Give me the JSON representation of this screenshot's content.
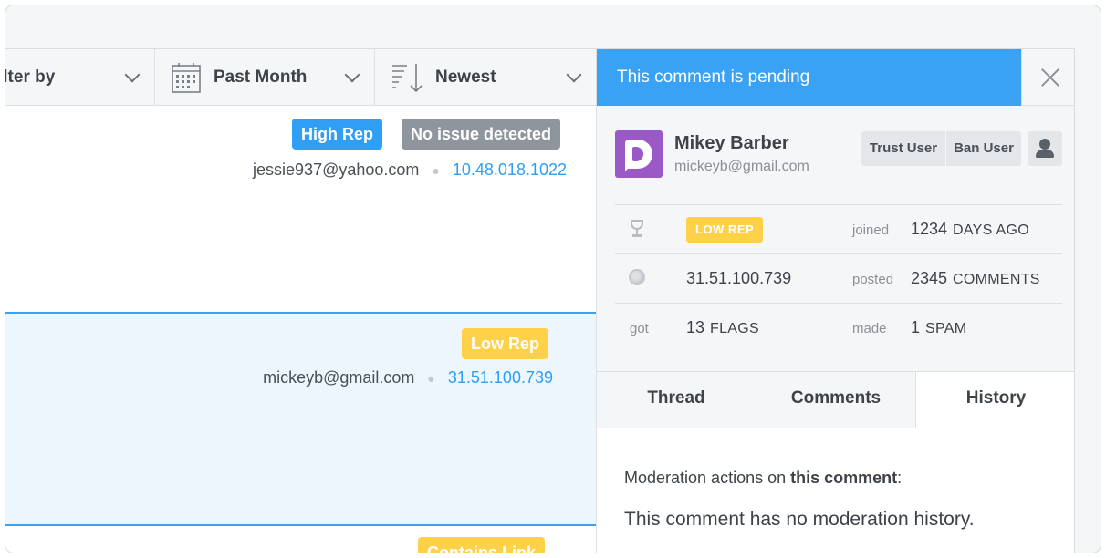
{
  "toolbar": {
    "filter_label": "ilter by",
    "date_label": "Past Month",
    "sort_label": "Newest",
    "calendar_icon": "calendar-icon",
    "sort_icon": "sort-descending-icon"
  },
  "comments": [
    {
      "badges": [
        "High Rep",
        "No issue detected"
      ],
      "email": "jessie937@yahoo.com",
      "ip": "10.48.018.1022"
    },
    {
      "badges": [
        "Low Rep"
      ],
      "email": "mickeyb@gmail.com",
      "ip": "31.51.100.739"
    },
    {
      "badges": [
        "Contains Link"
      ]
    }
  ],
  "panel": {
    "pending_text": "This comment is pending",
    "user": {
      "name": "Mikey Barber",
      "email": "mickeyb@gmail.com",
      "trust_label": "Trust User",
      "ban_label": "Ban User"
    },
    "stats": {
      "rep_badge": "LOW REP",
      "joined_label": "joined",
      "joined_value": "1234",
      "joined_unit": "DAYS AGO",
      "ip": "31.51.100.739",
      "posted_label": "posted",
      "posted_value": "2345",
      "posted_unit": "COMMENTS",
      "got_label": "got",
      "flags_value": "13",
      "flags_unit": "FLAGS",
      "made_label": "made",
      "spam_value": "1",
      "spam_unit": "SPAM"
    },
    "tabs": [
      "Thread",
      "Comments",
      "History"
    ],
    "active_tab": "History",
    "history": {
      "prefix": "Moderation actions on ",
      "emphasis": "this comment",
      "suffix": ":",
      "message": "This comment has no moderation history."
    }
  },
  "colors": {
    "accent": "#3aa2f5",
    "high_rep": "#2e9ff4",
    "neutral_badge": "#8e959d",
    "low_rep": "#ffd149",
    "avatar": "#9b59c8"
  }
}
